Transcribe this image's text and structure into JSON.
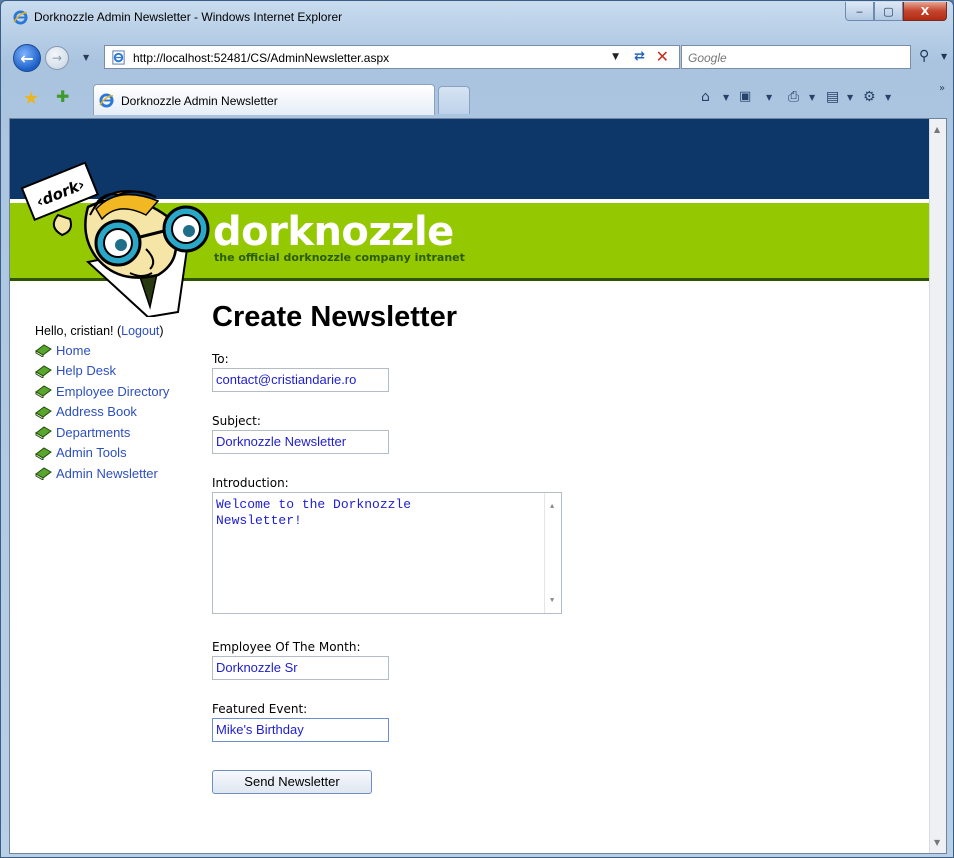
{
  "window": {
    "title": "Dorknozzle Admin Newsletter - Windows Internet Explorer",
    "controls": {
      "minimize": "‒",
      "maximize": "▢",
      "close": "X"
    }
  },
  "addressbar": {
    "url": "http://localhost:52481/CS/AdminNewsletter.aspx",
    "search_placeholder": "Google"
  },
  "tabs": [
    {
      "label": "Dorknozzle Admin Newsletter"
    }
  ],
  "site": {
    "brand": "dorknozzle",
    "tagline": "the official dorknozzle company intranet",
    "mascot_sign": "‹dork›"
  },
  "sidebar": {
    "greeting": "Hello, cristian! (",
    "logout": "Logout",
    "greeting_end": ")",
    "items": [
      {
        "label": "Home"
      },
      {
        "label": "Help Desk"
      },
      {
        "label": "Employee Directory"
      },
      {
        "label": "Address Book"
      },
      {
        "label": "Departments"
      },
      {
        "label": "Admin Tools"
      },
      {
        "label": "Admin Newsletter"
      }
    ]
  },
  "form": {
    "title": "Create Newsletter",
    "to_label": "To:",
    "to_value": "contact@cristiandarie.ro",
    "subject_label": "Subject:",
    "subject_value": "Dorknozzle Newsletter",
    "intro_label": "Introduction:",
    "intro_value": "Welcome to the Dorknozzle\nNewsletter!",
    "employee_label": "Employee Of The Month:",
    "employee_value": "Dorknozzle Sr",
    "event_label": "Featured Event:",
    "event_value": "Mike's Birthday",
    "submit_label": "Send Newsletter"
  },
  "colors": {
    "header_blue": "#0d3769",
    "header_green": "#94c800",
    "link": "#2c4fbd",
    "input_text": "#1e1ecf"
  }
}
